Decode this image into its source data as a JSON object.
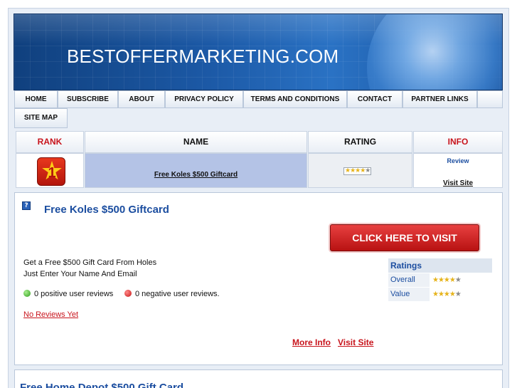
{
  "site": {
    "title": "BESTOFFERMARKETING.COM"
  },
  "nav": {
    "items": [
      {
        "label": "HOME"
      },
      {
        "label": "SUBSCRIBE"
      },
      {
        "label": "ABOUT"
      },
      {
        "label": "PRIVACY POLICY"
      },
      {
        "label": "TERMS AND CONDITIONS"
      },
      {
        "label": "CONTACT"
      },
      {
        "label": "PARTNER LINKS"
      },
      {
        "label": ""
      },
      {
        "label": "SITE MAP"
      }
    ]
  },
  "table": {
    "headers": {
      "rank": "RANK",
      "name": "NAME",
      "rating": "RATING",
      "info": "INFO"
    },
    "row": {
      "rank": "1",
      "name": "Free Koles $500 Giftcard",
      "stars_on": "★★★★",
      "stars_off": "★",
      "review": "Review",
      "visit": "Visit Site"
    }
  },
  "offer": {
    "title": "Free Koles $500 Giftcard",
    "cta": "CLICK HERE TO VISIT",
    "description_line1": "Get a Free $500 Gift Card From Holes",
    "description_line2": "Just Enter Your Name And Email",
    "positive_reviews": "0 positive user reviews",
    "negative_reviews": "0 negative user reviews.",
    "no_reviews": "No Reviews Yet",
    "ratings": {
      "heading": "Ratings",
      "rows": [
        {
          "label": "Overall",
          "stars_on": "★★★★",
          "stars_off": "★"
        },
        {
          "label": "Value",
          "stars_on": "★★★★",
          "stars_off": "★"
        }
      ]
    },
    "more_info": "More Info",
    "visit_site": "Visit Site"
  },
  "next_offer": {
    "title": "Free Home Depot $500 Gift Card"
  },
  "colors": {
    "accent_red": "#c8141c",
    "link_blue": "#1c4ea0",
    "header_blue": "#1c59a6"
  }
}
